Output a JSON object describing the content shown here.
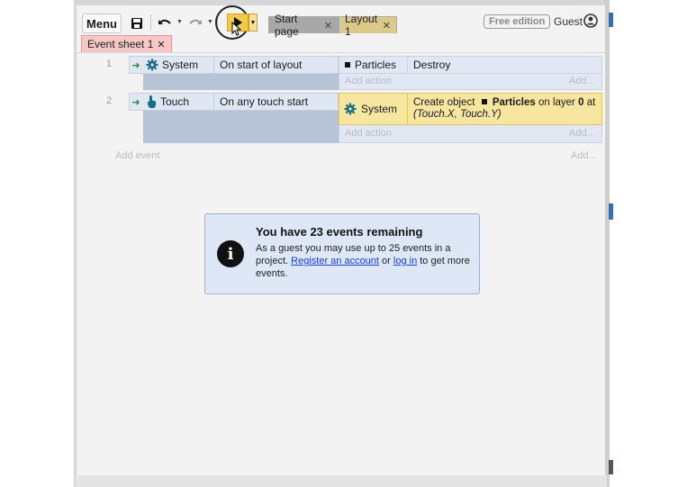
{
  "toolbar": {
    "menu_label": "Menu",
    "tabs": [
      {
        "label": "Start page"
      },
      {
        "label": "Layout 1"
      }
    ],
    "free_badge": "Free edition",
    "user_label": "Guest"
  },
  "sheet_tab": {
    "label": "Event sheet 1"
  },
  "events": [
    {
      "number": "1",
      "condition_object": "System",
      "condition_text": "On start of layout",
      "action_object": "Particles",
      "action_text": "Destroy",
      "add_action": "Add action",
      "add_more": "Add..."
    },
    {
      "number": "2",
      "condition_object": "Touch",
      "condition_text": "On any touch start",
      "action_object": "System",
      "action_text_prefix": "Create object",
      "action_text_obj": "Particles",
      "action_text_mid": "on layer",
      "action_text_layer": "0",
      "action_text_at": "at",
      "action_text_coords": "(Touch.X, Touch.Y)",
      "add_action": "Add action",
      "add_more": "Add..."
    }
  ],
  "add_event": "Add event",
  "add_event_more": "Add...",
  "notice": {
    "title": "You have 23 events remaining",
    "body_prefix": "As a guest you may use up to 25 events in a project.",
    "register_link": "Register an account",
    "or_text": "or",
    "login_link": "log in",
    "body_suffix": "to get more events."
  },
  "colors": {
    "accent_play": "#f3c94a",
    "condition_bg": "#dfe7f3",
    "action_highlight": "#f7e6a0",
    "sheet_tab": "#f6c7c7",
    "link": "#1b3bd1"
  }
}
